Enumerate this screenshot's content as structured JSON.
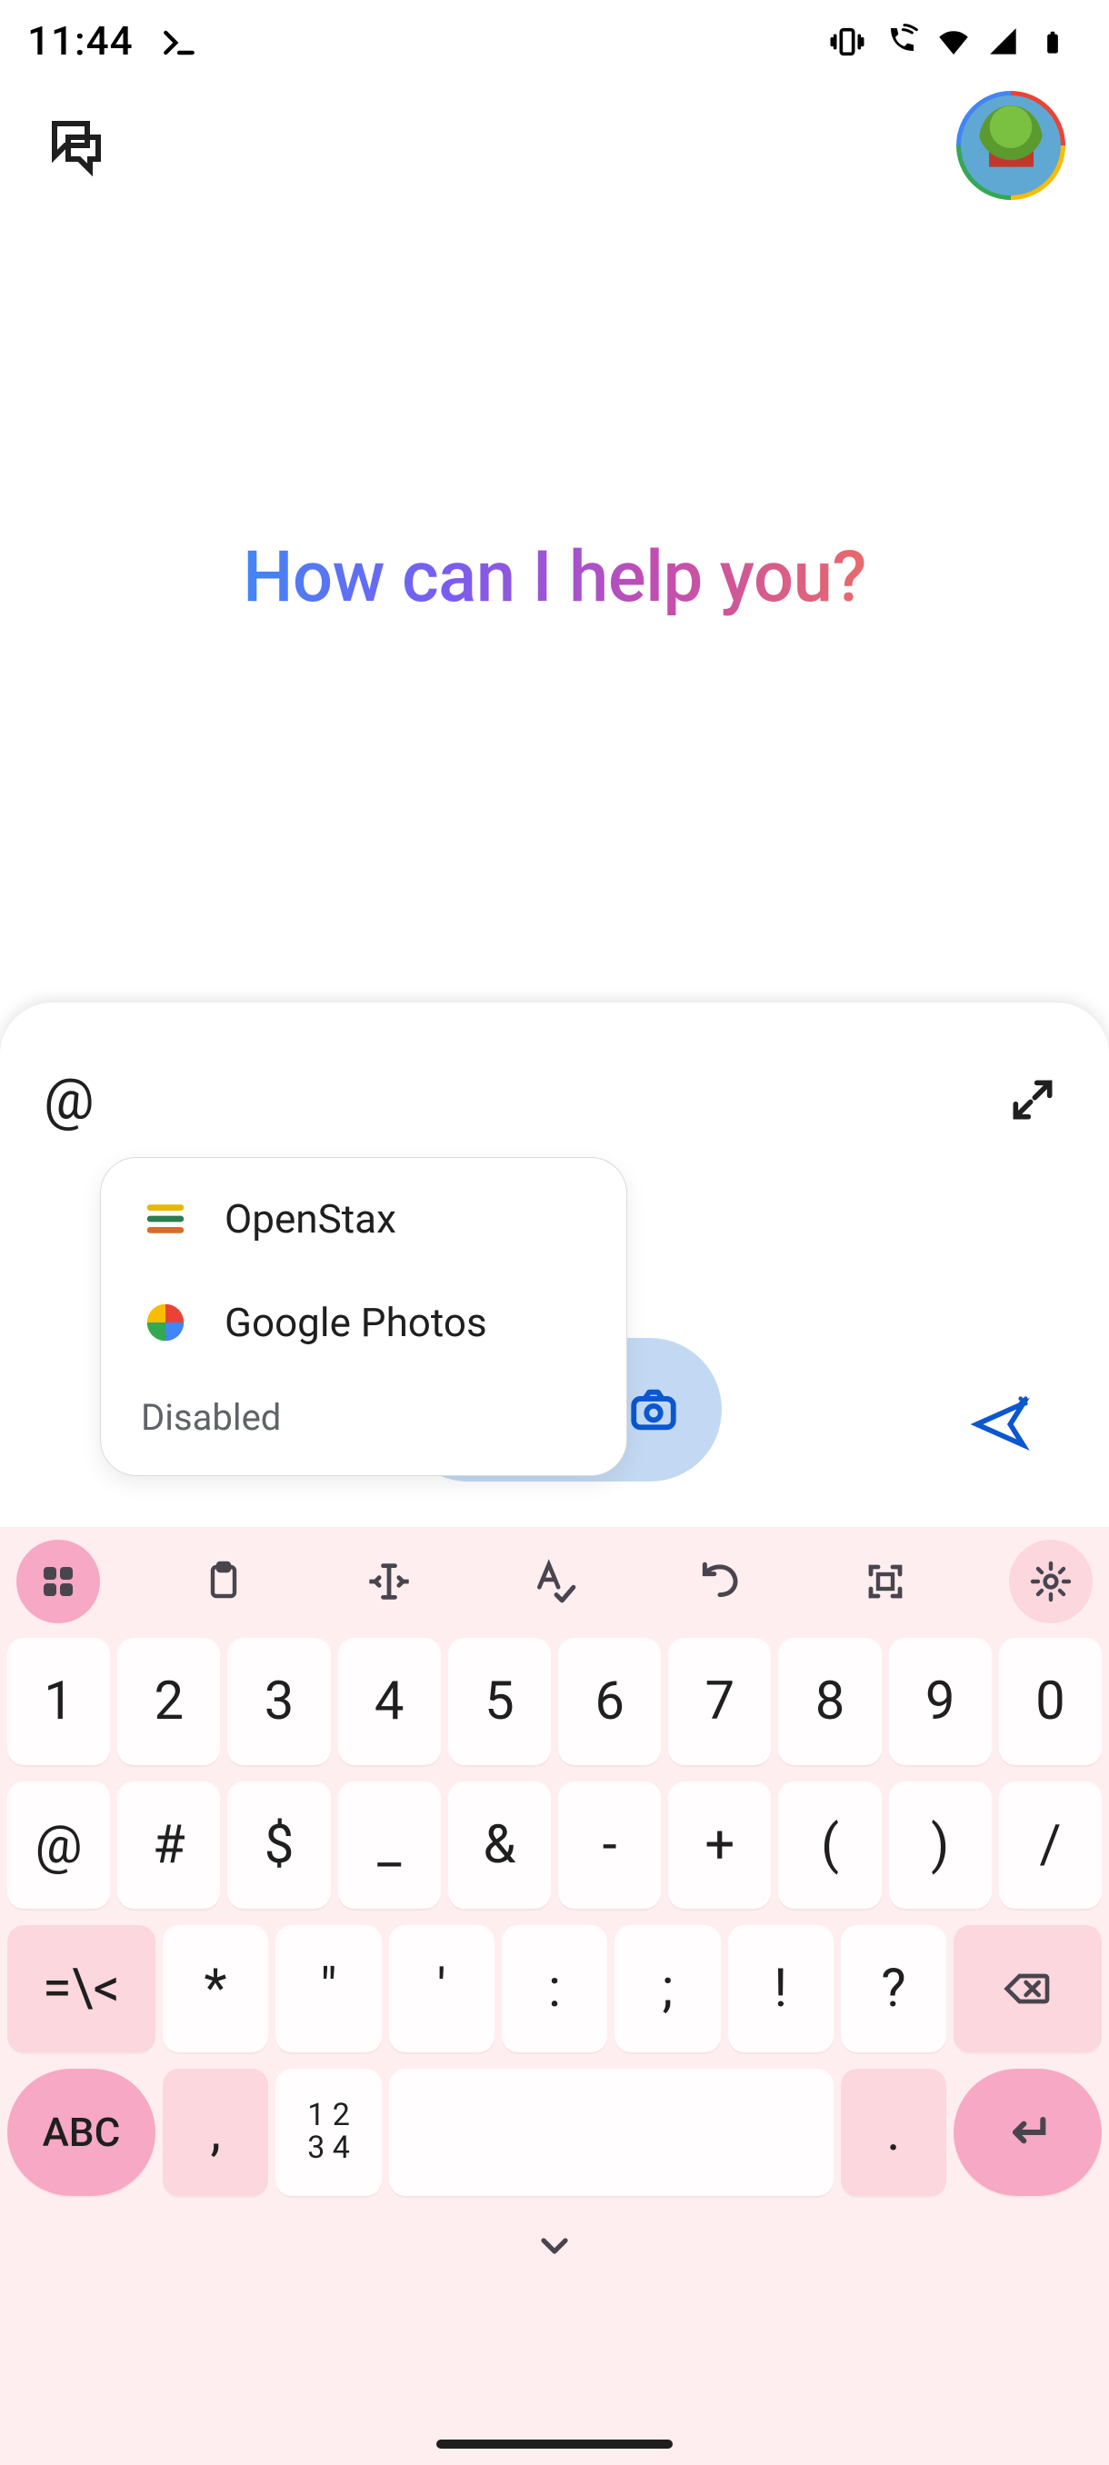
{
  "status": {
    "time": "11:44",
    "icons": [
      "terminal-icon",
      "vibrate-icon",
      "wifi-calling-icon",
      "wifi-icon",
      "cell-icon",
      "battery-icon"
    ]
  },
  "hero": {
    "text": "How can I help you?",
    "gradient": [
      "#4285f4",
      "#7b5cf0",
      "#c24db1",
      "#e86a6a"
    ]
  },
  "composer": {
    "text": "@",
    "expand_label": "Expand",
    "send_label": "Send"
  },
  "mentions": {
    "items": [
      {
        "label": "OpenStax",
        "icon": "openstax-icon"
      },
      {
        "label": "Google Photos",
        "icon": "google-photos-icon"
      }
    ],
    "disabled_label": "Disabled"
  },
  "keyboard": {
    "toolbar": [
      "grid",
      "clipboard",
      "text-cursor",
      "spellcheck",
      "undo",
      "scan",
      "settings"
    ],
    "row1": [
      "1",
      "2",
      "3",
      "4",
      "5",
      "6",
      "7",
      "8",
      "9",
      "0"
    ],
    "row2": [
      "@",
      "#",
      "$",
      "_",
      "&",
      "-",
      "+",
      "(",
      ")",
      "/"
    ],
    "row3_mode": "=\\<",
    "row3": [
      "*",
      "\"",
      "'",
      ":",
      ";",
      "!",
      "?"
    ],
    "abc_label": "ABC",
    "comma": ",",
    "numpad": "1 2\n3 4",
    "period": "."
  }
}
